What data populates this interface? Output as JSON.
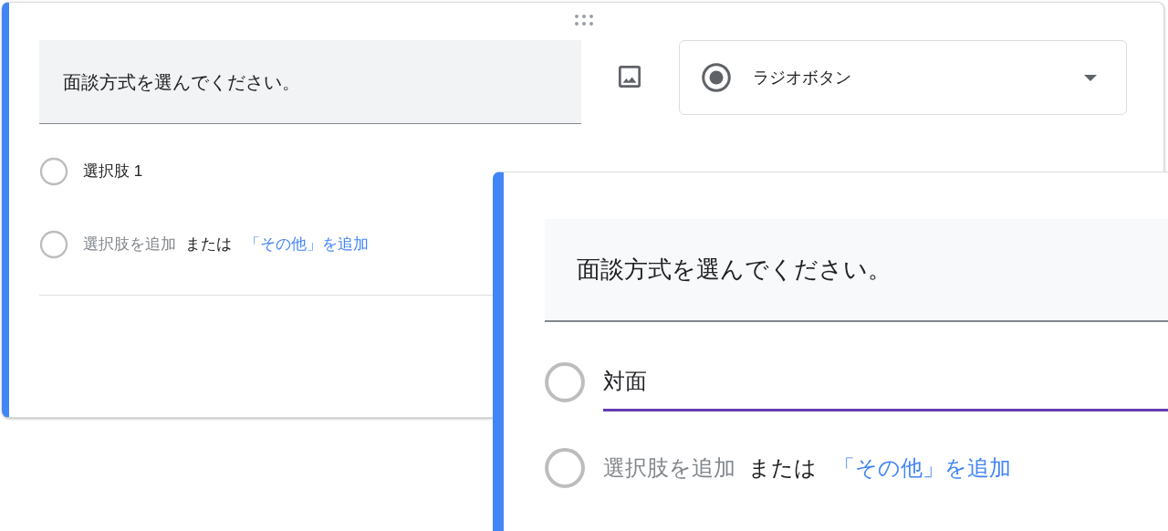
{
  "questions": [
    {
      "title": "面談方式を選んでください。",
      "type_menu": {
        "label": "ラジオボタン"
      },
      "options": [
        {
          "label": "選択肢 1",
          "focused": false,
          "selected": false
        }
      ],
      "add_option": {
        "prompt": "選択肢を追加",
        "separator": "または",
        "other_link": "「その他」を追加",
        "selected": false
      }
    },
    {
      "title": "面談方式を選んでください。",
      "options": [
        {
          "label": "対面",
          "focused": true,
          "selected": false
        }
      ],
      "add_option": {
        "prompt": "選択肢を追加",
        "separator": "または",
        "other_link": "「その他」を追加",
        "selected": false
      }
    }
  ]
}
